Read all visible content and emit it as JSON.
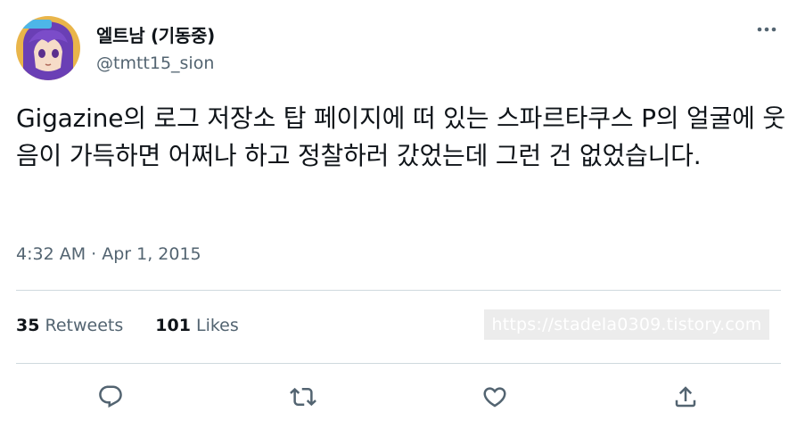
{
  "tweet": {
    "author": {
      "display_name": "엘트남 (기동중)",
      "handle": "@tmtt15_sion",
      "avatar_icon": "avatar-image"
    },
    "more_icon": "more-options-icon",
    "text": "Gigazine의 로그 저장소 탑 페이지에 떠 있는 스파르타쿠스 P의 얼굴에 웃음이 가득하면 어쩌나 하고 정찰하러 갔었는데 그런 건 없었습니다.",
    "timestamp": "4:32 AM · Apr 1, 2015",
    "stats": {
      "retweets_count": "35",
      "retweets_label": "Retweets",
      "likes_count": "101",
      "likes_label": "Likes"
    },
    "actions": [
      {
        "name": "reply",
        "icon": "reply-icon"
      },
      {
        "name": "retweet",
        "icon": "retweet-icon"
      },
      {
        "name": "like",
        "icon": "like-icon"
      },
      {
        "name": "share",
        "icon": "share-icon"
      }
    ]
  },
  "watermark": {
    "text": "https://stadela0309.tistory.com"
  },
  "colors": {
    "text_primary": "#0f1419",
    "text_secondary": "#536471",
    "divider": "#cfd9de",
    "watermark_bg": "#ececec"
  }
}
